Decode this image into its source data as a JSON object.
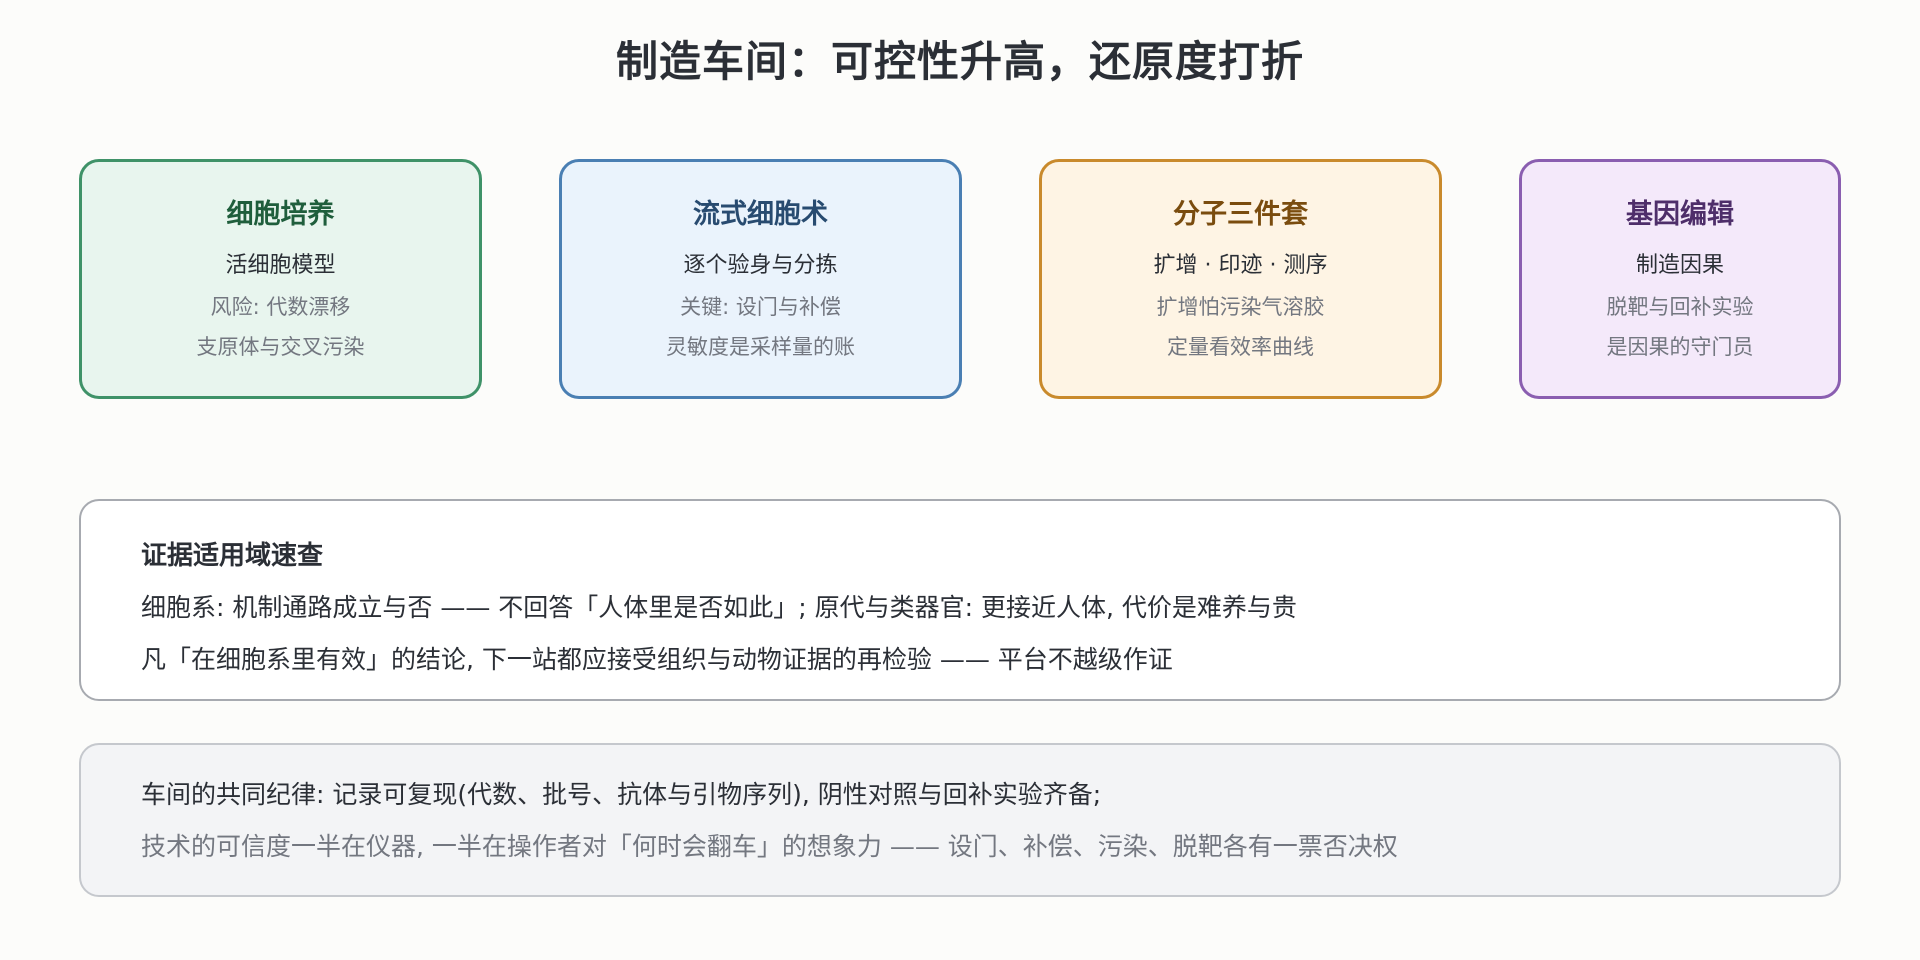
{
  "title": "制造车间：可控性升高，还原度打折",
  "cards": [
    {
      "heading": "细胞培养",
      "subtitle": "活细胞模型",
      "notes": [
        "风险: 代数漂移",
        "支原体与交叉污染"
      ]
    },
    {
      "heading": "流式细胞术",
      "subtitle": "逐个验身与分拣",
      "notes": [
        "关键: 设门与补偿",
        "灵敏度是采样量的账"
      ]
    },
    {
      "heading": "分子三件套",
      "subtitle": "扩增 · 印迹 · 测序",
      "notes": [
        "扩增怕污染气溶胶",
        "定量看效率曲线"
      ]
    },
    {
      "heading": "基因编辑",
      "subtitle": "制造因果",
      "notes": [
        "脱靶与回补实验",
        "是因果的守门员"
      ]
    }
  ],
  "evidence": {
    "title": "证据适用域速查",
    "lines": [
      "细胞系: 机制通路成立与否 —— 不回答「人体里是否如此」; 原代与类器官: 更接近人体, 代价是难养与贵",
      "凡「在细胞系里有效」的结论, 下一站都应接受组织与动物证据的再检验 —— 平台不越级作证"
    ]
  },
  "discipline": {
    "lines": [
      "车间的共同纪律: 记录可复现(代数、批号、抗体与引物序列), 阴性对照与回补实验齐备;",
      "技术的可信度一半在仪器, 一半在操作者对「何时会翻车」的想象力 —— 设门、补偿、污染、脱靶各有一票否决权"
    ]
  },
  "colors": {
    "card_green": "#3f9268",
    "card_blue": "#4a7fb3",
    "card_orange": "#c98a2c",
    "card_purple": "#8a5eb0"
  }
}
